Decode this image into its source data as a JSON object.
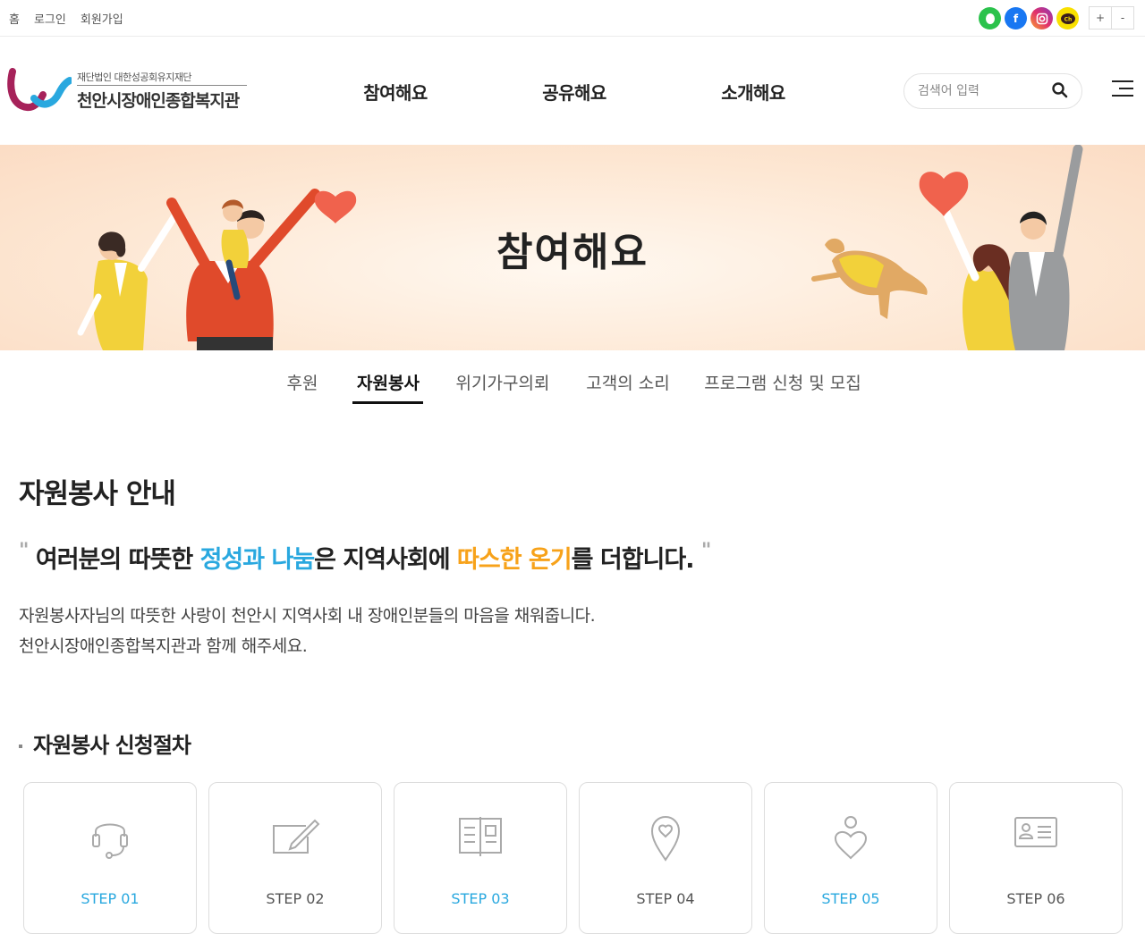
{
  "top_links": [
    "홈",
    "로그인",
    "회원가입"
  ],
  "sns": [
    {
      "name": "band",
      "glyph": "●",
      "color": "#2bc24c"
    },
    {
      "name": "facebook",
      "glyph": "f",
      "color": "#1877f2"
    },
    {
      "name": "instagram",
      "glyph": "◎",
      "color": "#e1306c"
    },
    {
      "name": "kakao-channel",
      "glyph": "Ch",
      "color": "#f9e000"
    }
  ],
  "zoom": {
    "in": "+",
    "out": "-"
  },
  "logo": {
    "sub": "재단법인 대한성공회유지재단",
    "main": "천안시장애인종합복지관"
  },
  "gnb": [
    "참여해요",
    "공유해요",
    "소개해요"
  ],
  "search": {
    "placeholder": "검색어 입력"
  },
  "banner": {
    "title": "참여해요"
  },
  "subnav": [
    "후원",
    "자원봉사",
    "위기가구의뢰",
    "고객의 소리",
    "프로그램 신청 및 모집"
  ],
  "subnav_active": "자원봉사",
  "content": {
    "title": "자원봉사 안내",
    "quote": {
      "open": "\"",
      "p1": "여러분의 따뜻한 ",
      "h1": "정성과 나눔",
      "p2": "은 지역사회에 ",
      "h2": "따스한 온기",
      "p3": "를 더합니다.",
      "close": "\""
    },
    "desc": [
      "자원봉사자님의 따뜻한 사랑이 천안시 지역사회 내 장애인분들의 마음을 채워줍니다.",
      "천안시장애인종합복지관과 함께 해주세요."
    ],
    "section_title": "자원봉사 신청절차",
    "steps": [
      {
        "label": "STEP 01",
        "icon": "headset-icon",
        "highlight": true
      },
      {
        "label": "STEP 02",
        "icon": "edit-form-icon",
        "highlight": false
      },
      {
        "label": "STEP 03",
        "icon": "book-icon",
        "highlight": true
      },
      {
        "label": "STEP 04",
        "icon": "location-heart-icon",
        "highlight": false
      },
      {
        "label": "STEP 05",
        "icon": "person-heart-icon",
        "highlight": true
      },
      {
        "label": "STEP 06",
        "icon": "id-card-icon",
        "highlight": false
      }
    ]
  },
  "colors": {
    "accent_blue": "#29a8df",
    "accent_orange": "#f7a21a"
  }
}
